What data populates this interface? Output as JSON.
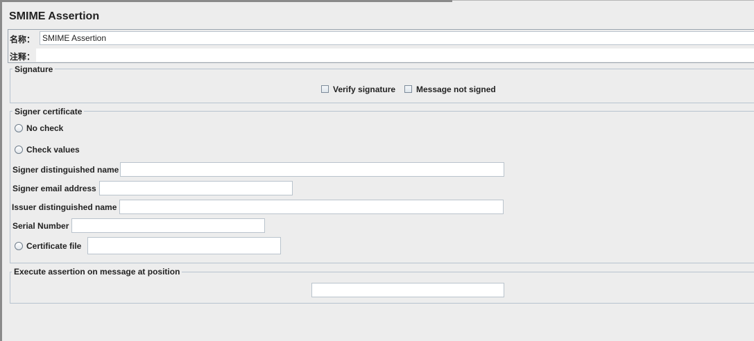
{
  "title": "SMIME Assertion",
  "name_label": "名称：",
  "name_value": "SMIME Assertion",
  "comment_label": "注释：",
  "comment_value": "",
  "signature": {
    "legend": "Signature",
    "verify_label": "Verify signature",
    "not_signed_label": "Message not signed"
  },
  "signer": {
    "legend": "Signer certificate",
    "no_check_label": "No check",
    "check_values_label": "Check values",
    "dn_label": "Signer distinguished name",
    "dn_value": "",
    "email_label": "Signer email address",
    "email_value": "",
    "issuer_label": "Issuer distinguished name",
    "issuer_value": "",
    "serial_label": "Serial Number",
    "serial_value": "",
    "cert_file_label": "Certificate file",
    "cert_file_value": ""
  },
  "position": {
    "legend": "Execute assertion on message at position",
    "value": ""
  }
}
